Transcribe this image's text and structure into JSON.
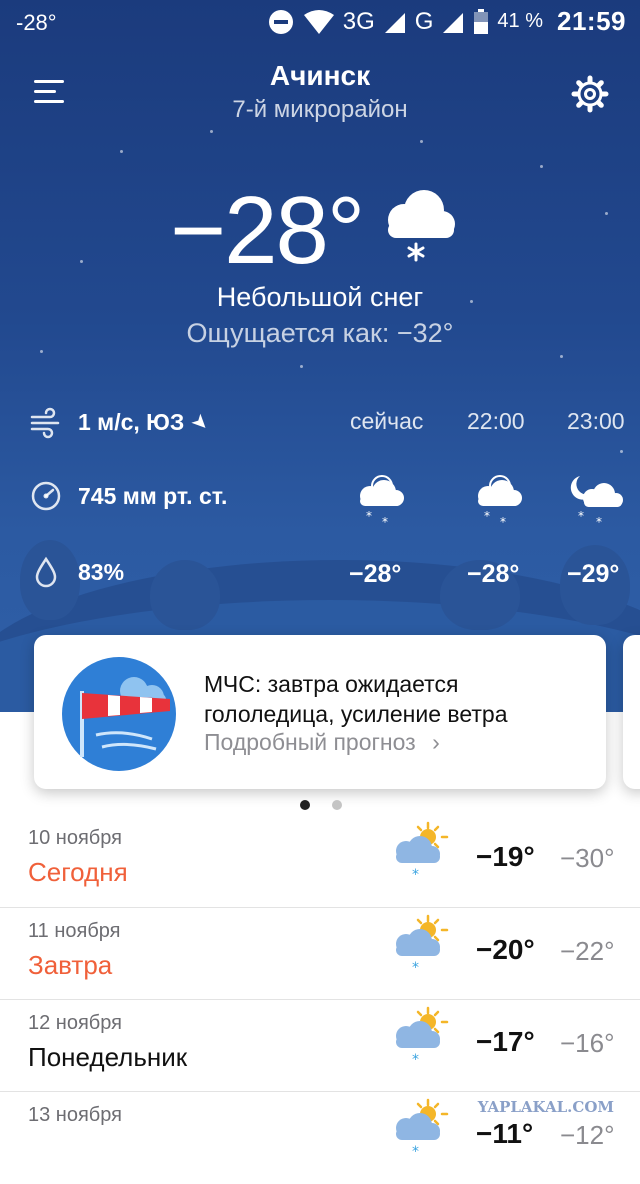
{
  "status_bar": {
    "left_temp": "-28°",
    "network_1": "3G",
    "network_2": "G",
    "battery": "41 %",
    "time": "21:59"
  },
  "header": {
    "city": "Ачинск",
    "district": "7-й микрорайон",
    "menu_icon": "hamburger-menu-icon",
    "settings_icon": "gear-icon"
  },
  "current": {
    "temperature": "−28°",
    "condition": "Небольшой снег",
    "feels_like": "Ощущается как: −32°",
    "icon": "cloud-snow-icon"
  },
  "details": {
    "wind": "1 м/с, ЮЗ",
    "pressure": "745 мм рт. ст.",
    "humidity": "83%"
  },
  "hourly": [
    {
      "label": "сейчас",
      "temp": "−28°",
      "icon": "cloud-snow-night-icon"
    },
    {
      "label": "22:00",
      "temp": "−28°",
      "icon": "cloud-snow-night-icon"
    },
    {
      "label": "23:00",
      "temp": "−29°",
      "icon": "moon-cloud-snow-icon"
    }
  ],
  "alert_card": {
    "text": "МЧС: завтра ожидается гололедица, усиление ветра",
    "link": "Подробный прогноз",
    "icon": "windsock-icon"
  },
  "forecast": [
    {
      "date": "10 ноября",
      "day": "Сегодня",
      "hi": "−19°",
      "lo": "−30°",
      "accent": true
    },
    {
      "date": "11 ноября",
      "day": "Завтра",
      "hi": "−20°",
      "lo": "−22°",
      "accent": true
    },
    {
      "date": "12 ноября",
      "day": "Понедельник",
      "hi": "−17°",
      "lo": "−16°",
      "accent": false
    },
    {
      "date": "13 ноября",
      "day": "",
      "hi": "−11°",
      "lo": "−12°",
      "accent": false
    }
  ],
  "watermark": "YAPLAKAL.COM",
  "colors": {
    "accent": "#f0603a",
    "hero_top": "#1b3b7d",
    "hero_bottom": "#2f60a8"
  }
}
